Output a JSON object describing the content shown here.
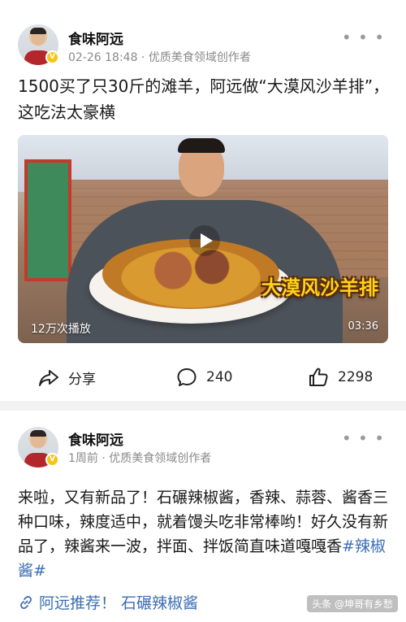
{
  "post1": {
    "author": "食味阿远",
    "meta": "02-26 18:48 · 优质美食领域创作者",
    "title": "1500买了只30斤的滩羊，阿远做“大漠风沙羊排”，这吃法太豪横",
    "video": {
      "caption": "大漠风沙羊排",
      "views": "12万次播放",
      "duration": "03:36"
    },
    "actions": {
      "share": "分享",
      "comments": "240",
      "likes": "2298"
    }
  },
  "post2": {
    "author": "食味阿远",
    "meta": "1周前 · 优质美食领域创作者",
    "text": "来啦，又有新品了！石碾辣椒酱，香辣、蒜蓉、酱香三种口味，辣度适中，就着馒头吃非常棒哟！好久没有新品了，辣酱来一波，拌面、拌饭简直味道嘎嘎香",
    "hashtag": "#辣椒酱#",
    "link_text": "阿远推荐！ 石碾辣椒酱"
  },
  "watermark": "头条 @坤哥有乡愁",
  "icons": {
    "verified": "verified-badge-icon",
    "more": "more-options-icon",
    "play": "play-icon",
    "share": "share-icon",
    "comment": "comment-icon",
    "like": "like-icon",
    "link": "link-icon"
  },
  "colors": {
    "link_blue": "#3d6eb3",
    "badge_yellow": "#f5c518",
    "caption_yellow": "#ffd21a"
  }
}
